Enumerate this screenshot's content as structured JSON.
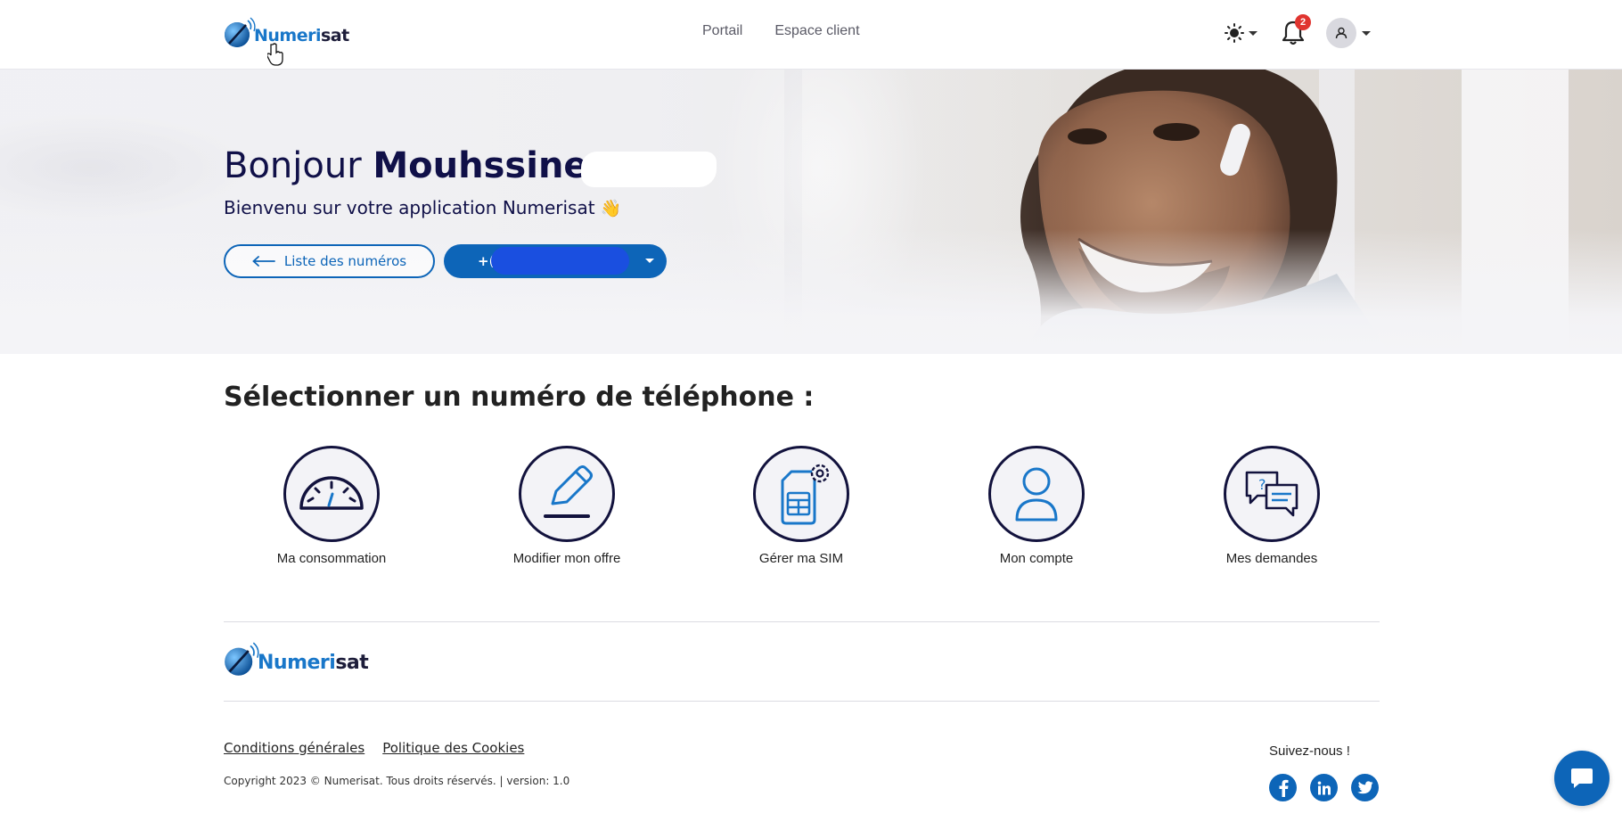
{
  "brand": {
    "name_part1": "Numeri",
    "name_part2": "sat",
    "primary_color": "#0d65b8",
    "dark_color": "#101048"
  },
  "navbar": {
    "links": [
      "Portail",
      "Espace client"
    ],
    "notifications_count": "2",
    "theme_icon": "sun-icon",
    "user_icon": "user-icon"
  },
  "hero": {
    "greeting_prefix": "Bonjour",
    "first_name": "Mouhssine",
    "welcome": "Bienvenu sur votre application Numerisat",
    "wave_emoji": "👋",
    "list_button": "Liste des numéros",
    "number_prefix": "+("
  },
  "section": {
    "title": "Sélectionner un numéro de téléphone :",
    "tiles": [
      {
        "label": "Ma consommation",
        "icon": "speedometer-icon"
      },
      {
        "label": "Modifier mon offre",
        "icon": "pencil-icon"
      },
      {
        "label": "Gérer ma SIM",
        "icon": "sim-settings-icon"
      },
      {
        "label": "Mon compte",
        "icon": "user-account-icon"
      },
      {
        "label": "Mes demandes",
        "icon": "chat-question-icon"
      }
    ]
  },
  "footer": {
    "links": [
      "Conditions générales",
      "Politique des Cookies"
    ],
    "copyright": "Copyright 2023 © Numerisat. Tous droits réservés. | version: 1.0",
    "follow": "Suivez-nous !",
    "socials": [
      "facebook-icon",
      "linkedin-icon",
      "twitter-icon"
    ]
  }
}
